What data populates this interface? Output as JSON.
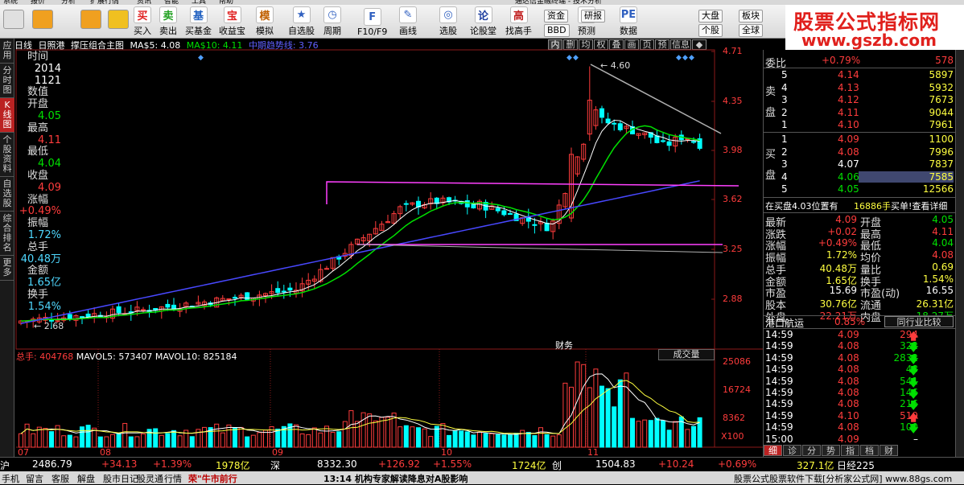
{
  "menubar": [
    "系统",
    "报价",
    "分析",
    "扩展行情",
    "资讯",
    "智能",
    "工具",
    "帮助",
    "通达信金融终端 - 技术分析"
  ],
  "toolbar": {
    "buttons": [
      {
        "label": "买入",
        "icon": "买",
        "color": "#e02020"
      },
      {
        "label": "卖出",
        "icon": "卖",
        "color": "#20a020"
      },
      {
        "label": "买基金",
        "icon": "基",
        "color": "#2060c0"
      },
      {
        "label": "收益宝",
        "icon": "宝",
        "color": "#e02020"
      },
      {
        "label": "模拟",
        "icon": "模",
        "color": "#c06000"
      },
      {
        "label": "自选股",
        "icon": "★",
        "color": "#3060c0"
      },
      {
        "label": "周期",
        "icon": "◷",
        "color": "#3060c0"
      },
      {
        "label": "F10/F9",
        "icon": "F",
        "color": "#3060c0"
      },
      {
        "label": "画线",
        "icon": "✎",
        "color": "#3060c0"
      },
      {
        "label": "选股",
        "icon": "◎",
        "color": "#3060c0"
      },
      {
        "label": "论股堂",
        "icon": "论",
        "color": "#2040a0"
      },
      {
        "label": "找高手",
        "icon": "高",
        "color": "#c02020"
      },
      {
        "label": "预测",
        "icon": "预",
        "color": "#3060c0"
      },
      {
        "label": "数据",
        "icon": "PE",
        "color": "#3060c0"
      }
    ],
    "small": [
      "资金",
      "研报",
      "BBD",
      "大盘",
      "板块",
      "个股",
      "全球"
    ]
  },
  "banner": {
    "line1": "股票公式指标网",
    "line2": "www.gszb.com"
  },
  "left_tabs": [
    "应用",
    "分时图",
    "K线图",
    "个股资料",
    "自选股",
    "综合排名",
    "更多"
  ],
  "chart_header": {
    "period": "日线",
    "stock": "日照港",
    "indicator": "撑压组合主图",
    "ma5": "MA$5: 4.08",
    "ma10": "MA$10: 4.11",
    "trend": "中期趋势线: 3.76"
  },
  "panel_tabs": [
    "内",
    "删",
    "均",
    "权",
    "叠",
    "画",
    "页",
    "预",
    "信息",
    "◆"
  ],
  "data_panel": [
    {
      "label": "时间",
      "value": "2014"
    },
    {
      "label": "",
      "value": "1121"
    },
    {
      "label": "数值",
      "value": ""
    },
    {
      "label": "开盘",
      "value": "4.05",
      "color": "grn"
    },
    {
      "label": "最高",
      "value": "4.11",
      "color": "red"
    },
    {
      "label": "最低",
      "value": "4.04",
      "color": "grn"
    },
    {
      "label": "收盘",
      "value": "4.09",
      "color": "red"
    },
    {
      "label": "涨幅",
      "value": "+0.49%",
      "color": "red"
    },
    {
      "label": "振幅",
      "value": "1.72%",
      "color": "cyn"
    },
    {
      "label": "总手",
      "value": "40.48万",
      "color": "cyn"
    },
    {
      "label": "金额",
      "value": "1.65亿",
      "color": "cyn"
    },
    {
      "label": "换手",
      "value": "1.54%",
      "color": "cyn"
    }
  ],
  "price_axis": [
    "4.71",
    "4.35",
    "3.98",
    "3.62",
    "3.25",
    "2.88"
  ],
  "vol_axis": [
    "25086",
    "16724",
    "8362",
    "X100"
  ],
  "date_axis": [
    "07",
    "08",
    "09",
    "10",
    "11"
  ],
  "annotations": {
    "high": "4.60",
    "low": "2.68",
    "report": "财务"
  },
  "vol_header": {
    "total": "总手: 404768",
    "mavol5": "MAVOL5: 573407",
    "mavol10": "MAVOL10: 825184"
  },
  "vol_button": "成交量",
  "order_book": {
    "title": "委比",
    "ratio": "+0.79%",
    "diff": "578",
    "sell_label": "卖盘",
    "buy_label": "买盘",
    "sells": [
      {
        "n": "5",
        "p": "4.14",
        "v": "5897"
      },
      {
        "n": "4",
        "p": "4.13",
        "v": "5932"
      },
      {
        "n": "3",
        "p": "4.12",
        "v": "7673"
      },
      {
        "n": "2",
        "p": "4.11",
        "v": "9044"
      },
      {
        "n": "1",
        "p": "4.10",
        "v": "7961"
      }
    ],
    "buys": [
      {
        "n": "1",
        "p": "4.09",
        "v": "1100"
      },
      {
        "n": "2",
        "p": "4.08",
        "v": "7996"
      },
      {
        "n": "3",
        "p": "4.07",
        "v": "7837"
      },
      {
        "n": "4",
        "p": "4.06",
        "v": "7585"
      },
      {
        "n": "5",
        "p": "4.05",
        "v": "12566"
      }
    ],
    "queue_text": "在买盘4.03位置有",
    "queue_vol": "16886手",
    "queue_link": "买单!查看详细"
  },
  "quote": [
    {
      "l1": "最新",
      "v1": "4.09",
      "c1": "red",
      "l2": "开盘",
      "v2": "4.05",
      "c2": "grn"
    },
    {
      "l1": "涨跌",
      "v1": "+0.02",
      "c1": "red",
      "l2": "最高",
      "v2": "4.11",
      "c2": "red"
    },
    {
      "l1": "涨幅",
      "v1": "+0.49%",
      "c1": "red",
      "l2": "最低",
      "v2": "4.04",
      "c2": "grn"
    },
    {
      "l1": "振幅",
      "v1": "1.72%",
      "c1": "yel",
      "l2": "均价",
      "v2": "4.08",
      "c2": "red"
    },
    {
      "l1": "总手",
      "v1": "40.48万",
      "c1": "yel",
      "l2": "量比",
      "v2": "0.69",
      "c2": "yel"
    },
    {
      "l1": "金额",
      "v1": "1.65亿",
      "c1": "yel",
      "l2": "换手",
      "v2": "1.54%",
      "c2": "yel"
    },
    {
      "l1": "市盈",
      "v1": "15.69",
      "c1": "wht",
      "l2": "市盈(动)",
      "v2": "16.55",
      "c2": "wht"
    },
    {
      "l1": "股本",
      "v1": "30.76亿",
      "c1": "yel",
      "l2": "流通",
      "v2": "26.31亿",
      "c2": "yel"
    },
    {
      "l1": "外盘",
      "v1": "22.21万",
      "c1": "red",
      "l2": "内盘",
      "v2": "18.27万",
      "c2": "grn"
    }
  ],
  "industry": {
    "name": "港口航运",
    "change": "0.85%",
    "button": "同行业比较"
  },
  "ticks": [
    {
      "t": "14:59",
      "p": "4.09",
      "v": "294",
      "d": "up"
    },
    {
      "t": "14:59",
      "p": "4.08",
      "v": "322",
      "d": "down"
    },
    {
      "t": "14:59",
      "p": "4.08",
      "v": "2832",
      "d": "down"
    },
    {
      "t": "14:59",
      "p": "4.08",
      "v": "48",
      "d": "down"
    },
    {
      "t": "14:59",
      "p": "4.08",
      "v": "541",
      "d": "down"
    },
    {
      "t": "14:59",
      "p": "4.08",
      "v": "146",
      "d": "down"
    },
    {
      "t": "14:59",
      "p": "4.08",
      "v": "216",
      "d": "down"
    },
    {
      "t": "14:59",
      "p": "4.10",
      "v": "519",
      "d": "up"
    },
    {
      "t": "14:59",
      "p": "4.08",
      "v": "100",
      "d": "down"
    },
    {
      "t": "15:00",
      "p": "4.09",
      "v": "–",
      "d": "none"
    }
  ],
  "right_tabs": [
    "细",
    "诊",
    "分",
    "势",
    "指",
    "档",
    "财"
  ],
  "index_bar": [
    {
      "text": "沪",
      "c": "wht"
    },
    {
      "text": "2486.79",
      "c": "wht"
    },
    {
      "text": "+34.13",
      "c": "red"
    },
    {
      "text": "+1.39%",
      "c": "red"
    },
    {
      "text": "1978亿",
      "c": "yel"
    },
    {
      "text": "深",
      "c": "wht"
    },
    {
      "text": "8332.30",
      "c": "wht"
    },
    {
      "text": "+126.92",
      "c": "red"
    },
    {
      "text": "+1.55%",
      "c": "red"
    },
    {
      "text": "1724亿",
      "c": "yel"
    },
    {
      "text": "创",
      "c": "wht"
    },
    {
      "text": "1504.83",
      "c": "wht"
    },
    {
      "text": "+10.24",
      "c": "red"
    },
    {
      "text": "+0.69%",
      "c": "red"
    },
    {
      "text": "327.1亿",
      "c": "yel"
    },
    {
      "text": "日经225",
      "c": "wht"
    }
  ],
  "status_bar": [
    "手机",
    "留言",
    "客服",
    "解盘",
    "股市日记",
    "股灵通",
    "行情",
    "荣\"牛市前行",
    "13:14 机构专家解读降息对A股影响",
    "股票公式股票软件下载[分析家公式网]  www.88gs.com"
  ],
  "colors": {
    "up": "#ff3c3c",
    "down": "#00ffff",
    "ma5": "#ffffff",
    "ma10": "#00e000",
    "trend": "#4848ff",
    "resist": "#ff40ff",
    "support": "#b0b0b0"
  }
}
